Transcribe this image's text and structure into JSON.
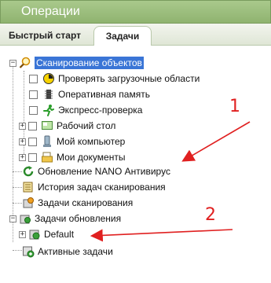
{
  "window": {
    "title": "Операции"
  },
  "tabs": [
    {
      "label": "Быстрый старт"
    },
    {
      "label": "Задачи"
    }
  ],
  "tree": {
    "scan": {
      "label": "Сканирование объектов",
      "children": [
        {
          "label": "Проверять загрузочные области"
        },
        {
          "label": "Оперативная память"
        },
        {
          "label": "Экспресс-проверка"
        },
        {
          "label": "Рабочий стол"
        },
        {
          "label": "Мой компьютер"
        },
        {
          "label": "Мои документы"
        }
      ]
    },
    "update_nano": {
      "label": "Обновление NANO Антивирус"
    },
    "scan_history": {
      "label": "История задач сканирования"
    },
    "scan_tasks": {
      "label": "Задачи сканирования"
    },
    "update_tasks": {
      "label": "Задачи обновления",
      "children": [
        {
          "label": "Default"
        }
      ]
    },
    "active_tasks": {
      "label": "Активные задачи"
    }
  },
  "annotations": [
    {
      "label": "1"
    },
    {
      "label": "2"
    }
  ],
  "colors": {
    "accent": "#3a75d6",
    "header": "#97b978",
    "arrow": "#e02020"
  }
}
